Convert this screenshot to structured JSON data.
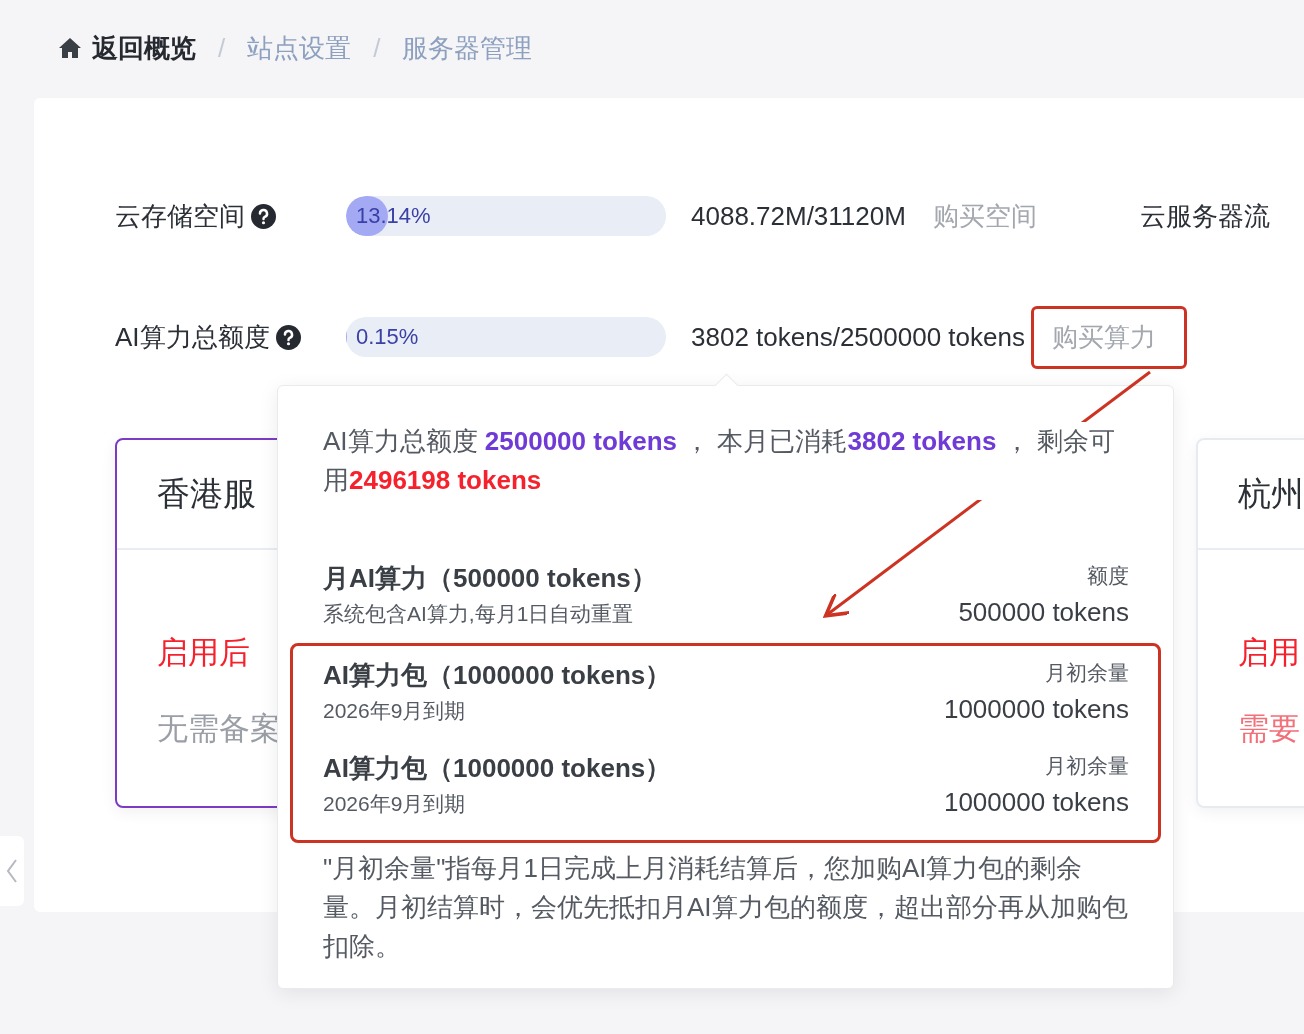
{
  "breadcrumb": [
    {
      "label": "返回概览",
      "kind": "home"
    },
    {
      "separator": "/",
      "label": "站点设置",
      "kind": "link"
    },
    {
      "separator": "/",
      "label": "服务器管理",
      "kind": "link"
    }
  ],
  "quotas": [
    {
      "label": "云存储空间",
      "level": 0.1314,
      "percent": "13.14%",
      "usage": "4088.72M/31120M",
      "action": "购买空间",
      "highlighted": false
    },
    {
      "label": "AI算力总额度",
      "level": 0.0015,
      "percent": "0.15%",
      "usage": "3802 tokens/2500000 tokens",
      "action": "购买算力",
      "highlighted": true
    }
  ],
  "side_label": "云服务器流",
  "server_cards": [
    {
      "title": "香港服",
      "notice": "启用后",
      "note": {
        "text": "无需备案",
        "color": "#9a9ea6"
      },
      "selected": true
    },
    {
      "title": "杭州",
      "notice": "启用",
      "note": {
        "text": "需要",
        "color": "#f2707a"
      },
      "selected": false
    }
  ],
  "popover": {
    "summary": [
      {
        "text": "AI算力总额度 ",
        "kind": "plain"
      },
      {
        "text": "2500000 tokens",
        "kind": "total"
      },
      {
        "text": " ， 本月已消耗",
        "kind": "plain"
      },
      {
        "text": "3802 tokens",
        "kind": "total"
      },
      {
        "text": " ， 剩余可用",
        "kind": "plain"
      },
      {
        "text": "2496198 tokens",
        "kind": "remaining"
      }
    ],
    "packages": [
      {
        "kind": "monthly",
        "title": "月AI算力（500000 tokens）",
        "subtitle": "系统包含AI算力,每月1日自动重置",
        "amount_label": "额度",
        "amount": "500000 tokens"
      },
      {
        "kind": "addon",
        "title": "AI算力包（1000000 tokens）",
        "subtitle": "2026年9月到期",
        "amount_label": "月初余量",
        "amount": "1000000 tokens"
      },
      {
        "kind": "addon",
        "title": "AI算力包（1000000 tokens）",
        "subtitle": "2026年9月到期",
        "amount_label": "月初余量",
        "amount": "1000000 tokens"
      }
    ],
    "note": "\"月初余量\"指每月1日完成上月消耗结算后，您加购AI算力包的剩余量。月初结算时，会优先抵扣月AI算力包的额度，超出部分再从加购包扣除。"
  }
}
